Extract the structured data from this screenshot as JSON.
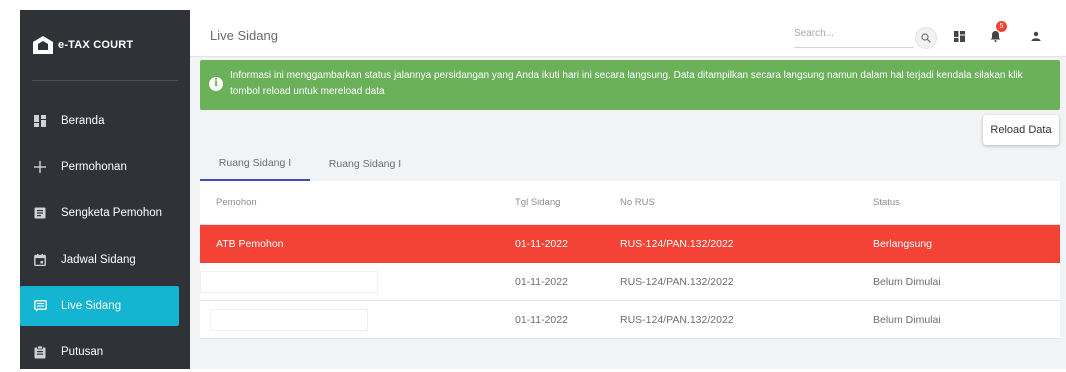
{
  "brand": {
    "name": "e-TAX COURT"
  },
  "sidebar": {
    "items": [
      {
        "label": "Beranda",
        "icon": "dashboard-icon"
      },
      {
        "label": "Permohonan",
        "icon": "plus-icon"
      },
      {
        "label": "Sengketa Pemohon",
        "icon": "document-icon"
      },
      {
        "label": "Jadwal Sidang",
        "icon": "calendar-icon"
      },
      {
        "label": "Live Sidang",
        "icon": "chat-icon",
        "active": true
      },
      {
        "label": "Putusan",
        "icon": "clipboard-icon"
      }
    ]
  },
  "header": {
    "title": "Live Sidang",
    "search_placeholder": "Search...",
    "notification_count": "5"
  },
  "alert": {
    "text": "Informasi ini menggambarkan status jalannya persidangan yang Anda ikuti hari ini secara langsung. Data ditampilkan secara langsung namun dalam hal terjadi kendala silakan klik tombol reload untuk mereload data"
  },
  "reload_label": "Reload Data",
  "tabs": [
    "Ruang Sidang I",
    "Ruang Sidang I"
  ],
  "table": {
    "columns": [
      "Pemohon",
      "Tgl Sidang",
      "No RUS",
      "Status"
    ],
    "rows": [
      {
        "pemohon": "ATB Pemohon",
        "tgl": "01-11-2022",
        "no_rus": "RUS-124/PAN.132/2022",
        "status": "Berlangsung"
      },
      {
        "pemohon": "",
        "tgl": "01-11-2022",
        "no_rus": "RUS-124/PAN.132/2022",
        "status": "Belum Dimulai"
      },
      {
        "pemohon": "",
        "tgl": "01-11-2022",
        "no_rus": "RUS-124/PAN.132/2022",
        "status": "Belum Dimulai"
      }
    ]
  },
  "colors": {
    "sidebar_bg": "#2f3338",
    "active_item": "#13b5d1",
    "alert_bg": "#6ab15a",
    "highlight_row": "#f44336",
    "tab_indicator": "#3f51b5"
  }
}
